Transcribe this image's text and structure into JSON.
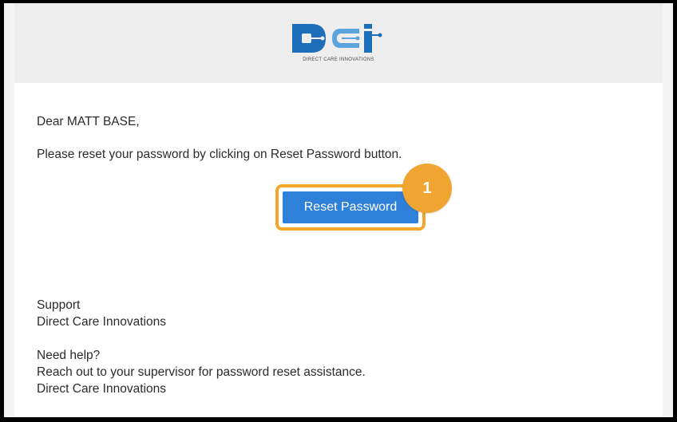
{
  "logo": {
    "tagline": "DIRECT CARE INNOVATIONS",
    "colors": {
      "primary": "#1c6fb8",
      "secondary": "#5aa4dd"
    }
  },
  "email": {
    "greeting": "Dear MATT BASE,",
    "instructions": "Please reset your password by clicking on Reset Password button.",
    "button_label": "Reset Password",
    "signature": [
      "Support",
      "Direct Care Innovations"
    ],
    "help": [
      "Need help?",
      "Reach out to your supervisor for password reset assistance.",
      "Direct Care Innovations"
    ]
  },
  "callout": {
    "number": "1",
    "color": "#f0a531"
  },
  "colors": {
    "button": "#2f80d8",
    "highlight": "#f3a62d"
  }
}
